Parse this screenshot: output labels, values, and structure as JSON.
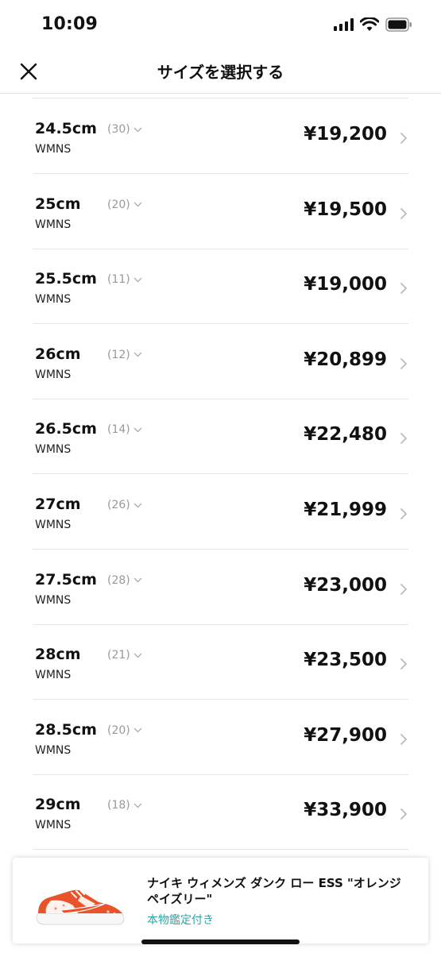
{
  "status_bar": {
    "time": "10:09"
  },
  "header": {
    "title": "サイズを選択する"
  },
  "sizes": [
    {
      "size": "24.5cm",
      "sub": "WMNS",
      "count": "(30)",
      "price": "¥19,200"
    },
    {
      "size": "25cm",
      "sub": "WMNS",
      "count": "(20)",
      "price": "¥19,500"
    },
    {
      "size": "25.5cm",
      "sub": "WMNS",
      "count": "(11)",
      "price": "¥19,000"
    },
    {
      "size": "26cm",
      "sub": "WMNS",
      "count": "(12)",
      "price": "¥20,899"
    },
    {
      "size": "26.5cm",
      "sub": "WMNS",
      "count": "(14)",
      "price": "¥22,480"
    },
    {
      "size": "27cm",
      "sub": "WMNS",
      "count": "(26)",
      "price": "¥21,999"
    },
    {
      "size": "27.5cm",
      "sub": "WMNS",
      "count": "(28)",
      "price": "¥23,000"
    },
    {
      "size": "28cm",
      "sub": "WMNS",
      "count": "(21)",
      "price": "¥23,500"
    },
    {
      "size": "28.5cm",
      "sub": "WMNS",
      "count": "(20)",
      "price": "¥27,900"
    },
    {
      "size": "29cm",
      "sub": "WMNS",
      "count": "(18)",
      "price": "¥33,900"
    }
  ],
  "product": {
    "name": "ナイキ ウィメンズ ダンク ロー ESS \"オレンジ ペイズリー\"",
    "badge": "本物鑑定付き"
  },
  "colors": {
    "accent": "#2ea4a6",
    "divider": "#e6e6e6",
    "muted": "#999999",
    "shoe_orange": "#e8532a"
  }
}
